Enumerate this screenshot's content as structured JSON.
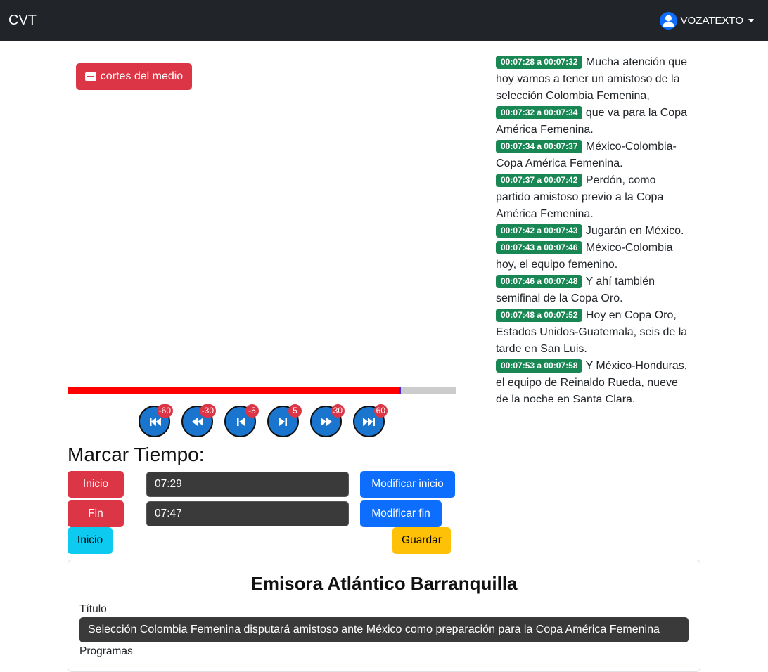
{
  "navbar": {
    "brand": "CVT",
    "user": "VOZATEXTO"
  },
  "player": {
    "cortes_button": "cortes del medio",
    "progress_fraction": 0.855,
    "seek_buttons": [
      {
        "badge": "-60",
        "icon": "skip-back-icon"
      },
      {
        "badge": "-30",
        "icon": "rewind-icon"
      },
      {
        "badge": "-5",
        "icon": "step-back-icon"
      },
      {
        "badge": "5",
        "icon": "step-forward-icon"
      },
      {
        "badge": "30",
        "icon": "fast-forward-icon"
      },
      {
        "badge": "60",
        "icon": "skip-forward-icon"
      }
    ]
  },
  "marcar": {
    "title": "Marcar Tiempo:",
    "inicio_button": "Inicio",
    "inicio_value": "07:29",
    "modificar_inicio": "Modificar inicio",
    "fin_button": "Fin",
    "fin_value": "07:47",
    "modificar_fin": "Modificar fin",
    "go_inicio_button": "Inicio",
    "guardar_button": "Guardar"
  },
  "transcript": [
    {
      "time": "00:07:28 a 00:07:32",
      "text": "Mucha atención que hoy vamos a tener un amistoso de la selección Colombia Femenina,"
    },
    {
      "time": "00:07:32 a 00:07:34",
      "text": "que va para la Copa América Femenina."
    },
    {
      "time": "00:07:34 a 00:07:37",
      "text": "México-Colombia-Copa América Femenina."
    },
    {
      "time": "00:07:37 a 00:07:42",
      "text": "Perdón, como partido amistoso previo a la Copa América Femenina."
    },
    {
      "time": "00:07:42 a 00:07:43",
      "text": "Jugarán en México."
    },
    {
      "time": "00:07:43 a 00:07:46",
      "text": "México-Colombia hoy, el equipo femenino."
    },
    {
      "time": "00:07:46 a 00:07:48",
      "text": "Y ahí también semifinal de la Copa Oro."
    },
    {
      "time": "00:07:48 a 00:07:52",
      "text": "Hoy en Copa Oro, Estados Unidos-Guatemala, seis de la tarde en San Luis."
    },
    {
      "time": "00:07:53 a 00:07:58",
      "text": "Y México-Honduras, el equipo de Reinaldo Rueda, nueve de la noche en Santa Clara."
    }
  ],
  "card": {
    "title": "Emisora Atlántico Barranquilla",
    "titulo_label": "Título",
    "titulo_value": "Selección Colombia Femenina disputará amistoso ante México como preparación para la Copa América Femenina",
    "programas_label": "Programas"
  }
}
